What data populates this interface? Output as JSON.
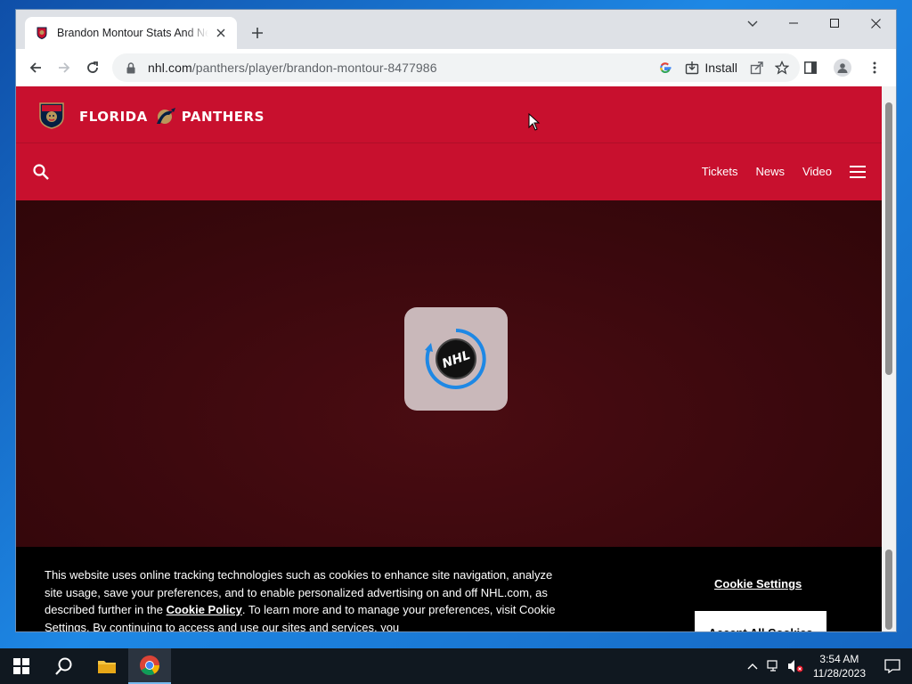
{
  "browser": {
    "tab_title": "Brandon Montour Stats And News",
    "url_host": "nhl.com",
    "url_path": "/panthers/player/brandon-montour-8477986",
    "install_label": "Install"
  },
  "site": {
    "wordmark_left": "FLORIDA",
    "wordmark_right": "PANTHERS",
    "nav_links": [
      "Tickets",
      "News",
      "Video"
    ],
    "loader_text": "NHL"
  },
  "cookie_banner": {
    "text_before": "This website uses online tracking technologies such as cookies to enhance site navigation, analyze site usage, save your preferences, and to enable personalized advertising on and off NHL.com, as described further in the ",
    "policy_link": "Cookie Policy",
    "text_after": ". To learn more and to manage your preferences, visit Cookie Settings. By continuing to access and use our sites and services, you",
    "settings_label": "Cookie Settings",
    "accept_label": "Accept All Cookies"
  },
  "taskbar": {
    "time": "3:54 AM",
    "date": "11/28/2023"
  },
  "colors": {
    "brand_red": "#c8102e",
    "hero_dark": "#3c0a0e",
    "loader_blue": "#1e88e5"
  }
}
